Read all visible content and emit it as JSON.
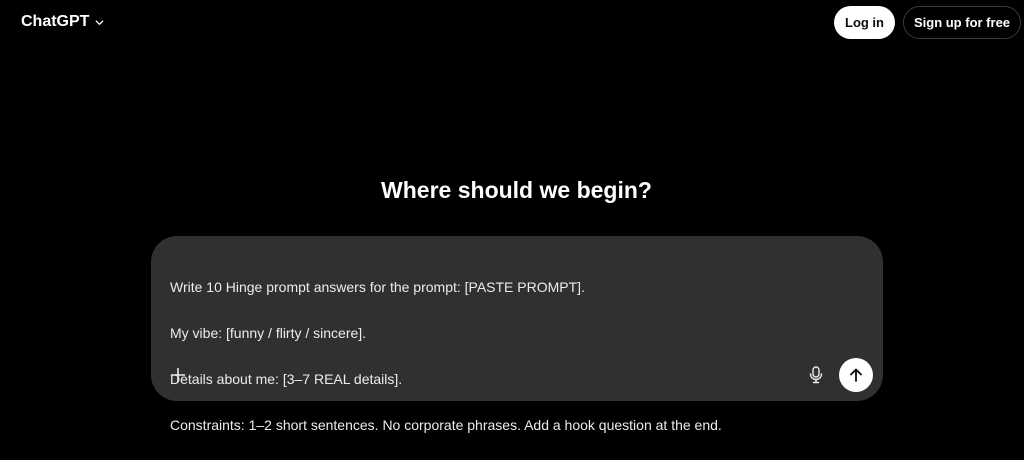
{
  "header": {
    "brand_label": "ChatGPT",
    "brand_icon": "chevron-down-icon",
    "login_label": "Log in",
    "signup_label": "Sign up for free"
  },
  "main": {
    "headline": "Where should we begin?"
  },
  "composer": {
    "lines": [
      "Write 10 Hinge prompt answers for the prompt: [PASTE PROMPT].",
      "My vibe: [funny / flirty / sincere].",
      "Details about me: [3–7 REAL details].",
      "Constraints: 1–2 short sentences. No corporate phrases. Add a hook question at the end."
    ],
    "icons": {
      "attach": "plus-icon",
      "voice": "microphone-icon",
      "send": "arrow-up-icon"
    }
  },
  "colors": {
    "background": "#000000",
    "composer_bg": "#303030",
    "primary_button_bg": "#ffffff",
    "text": "#ffffff"
  }
}
